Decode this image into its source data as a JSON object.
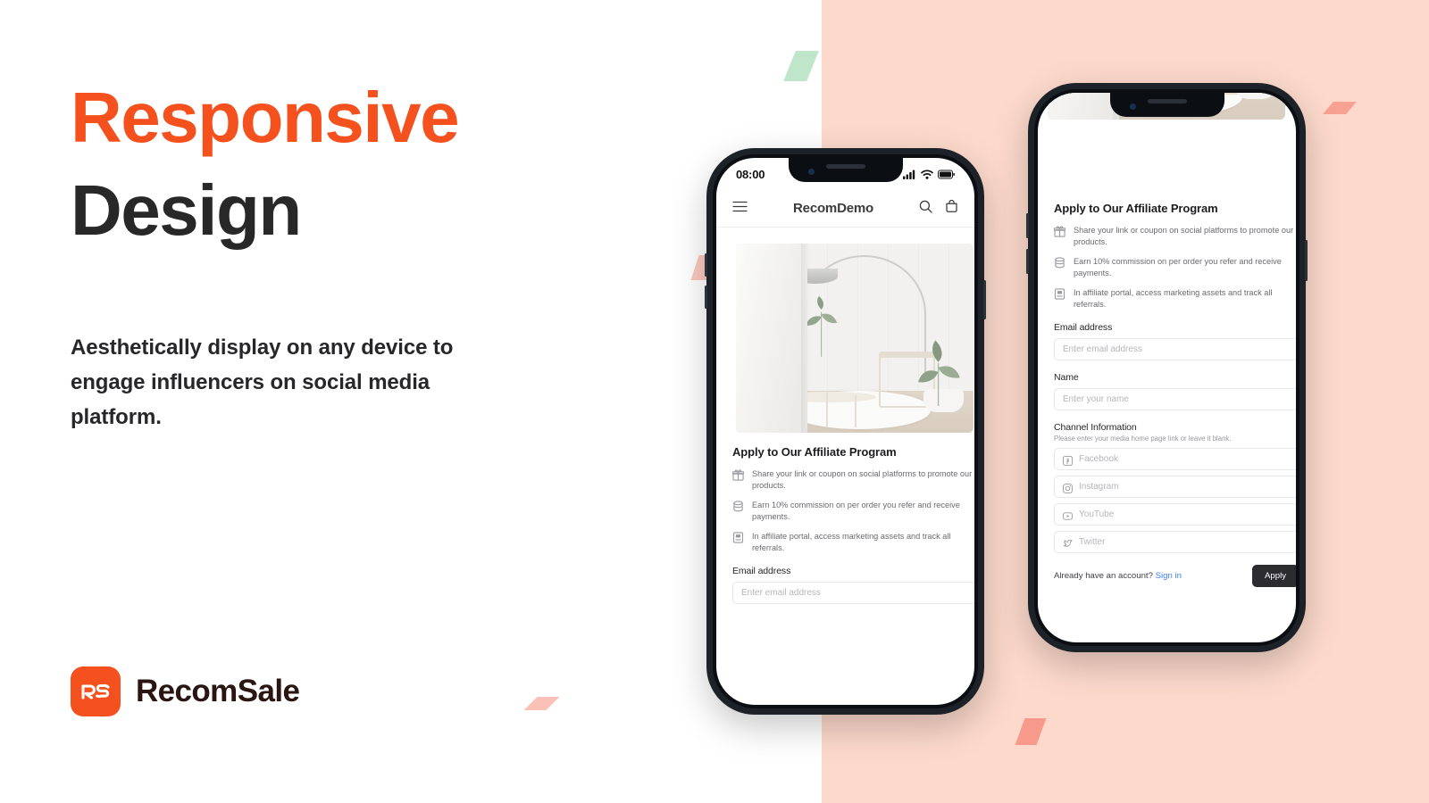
{
  "theme": {
    "accent_orange": "#F4511E",
    "dark_text": "#282828",
    "bg_left": "#FFFFFF",
    "bg_right": "#FCD9CB",
    "link_blue": "#3B82F6",
    "button_dark": "#2B2B30",
    "decor_green": "#BFE6C8",
    "decor_pink": "#F79A8C"
  },
  "hero": {
    "headline_line1": "Responsive",
    "headline_line2": "Design",
    "subcopy": "Aesthetically display on any device to engage influencers on social media platform."
  },
  "logo": {
    "mark_text": "RS",
    "wordmark": "RecomSale"
  },
  "phone1": {
    "status": {
      "time": "08:00",
      "icons": [
        "cellular-signal-icon",
        "wifi-icon",
        "battery-icon"
      ]
    },
    "header": {
      "menu_icon": "hamburger-menu-icon",
      "brand": "RecomDemo",
      "search_icon": "search-icon",
      "cart_icon": "shopping-bag-icon"
    },
    "hero_image_alt": "minimalist-living-room-photo",
    "section_title": "Apply to Our Affiliate Program",
    "benefits": [
      {
        "icon": "gift-icon",
        "text": "Share your link or coupon on social platforms to promote our products."
      },
      {
        "icon": "coins-icon",
        "text": "Earn 10% commission on per order you refer and receive payments."
      },
      {
        "icon": "portal-icon",
        "text": "In affiliate portal, access marketing assets and track all referrals."
      }
    ],
    "email_label": "Email address",
    "email_placeholder": "Enter email address"
  },
  "phone2": {
    "hero_image_alt": "minimalist-living-room-photo-scrolled",
    "section_title": "Apply to Our Affiliate Program",
    "benefits": [
      {
        "icon": "gift-icon",
        "text": "Share your link or coupon on social platforms to promote our products."
      },
      {
        "icon": "coins-icon",
        "text": "Earn 10% commission on per order you refer and receive payments."
      },
      {
        "icon": "portal-icon",
        "text": "In affiliate portal, access marketing assets and track all referrals."
      }
    ],
    "email_label": "Email address",
    "email_placeholder": "Enter email address",
    "name_label": "Name",
    "name_placeholder": "Enter your name",
    "channel_label": "Channel Information",
    "channel_hint": "Please enter your media home page link or leave it blank.",
    "channels": [
      {
        "icon": "facebook-icon",
        "placeholder": "Facebook"
      },
      {
        "icon": "instagram-icon",
        "placeholder": "Instagram"
      },
      {
        "icon": "youtube-icon",
        "placeholder": "YouTube"
      },
      {
        "icon": "twitter-icon",
        "placeholder": "Twitter"
      }
    ],
    "footer_text": "Already have an account?",
    "footer_link": "Sign in",
    "apply_label": "Apply"
  }
}
